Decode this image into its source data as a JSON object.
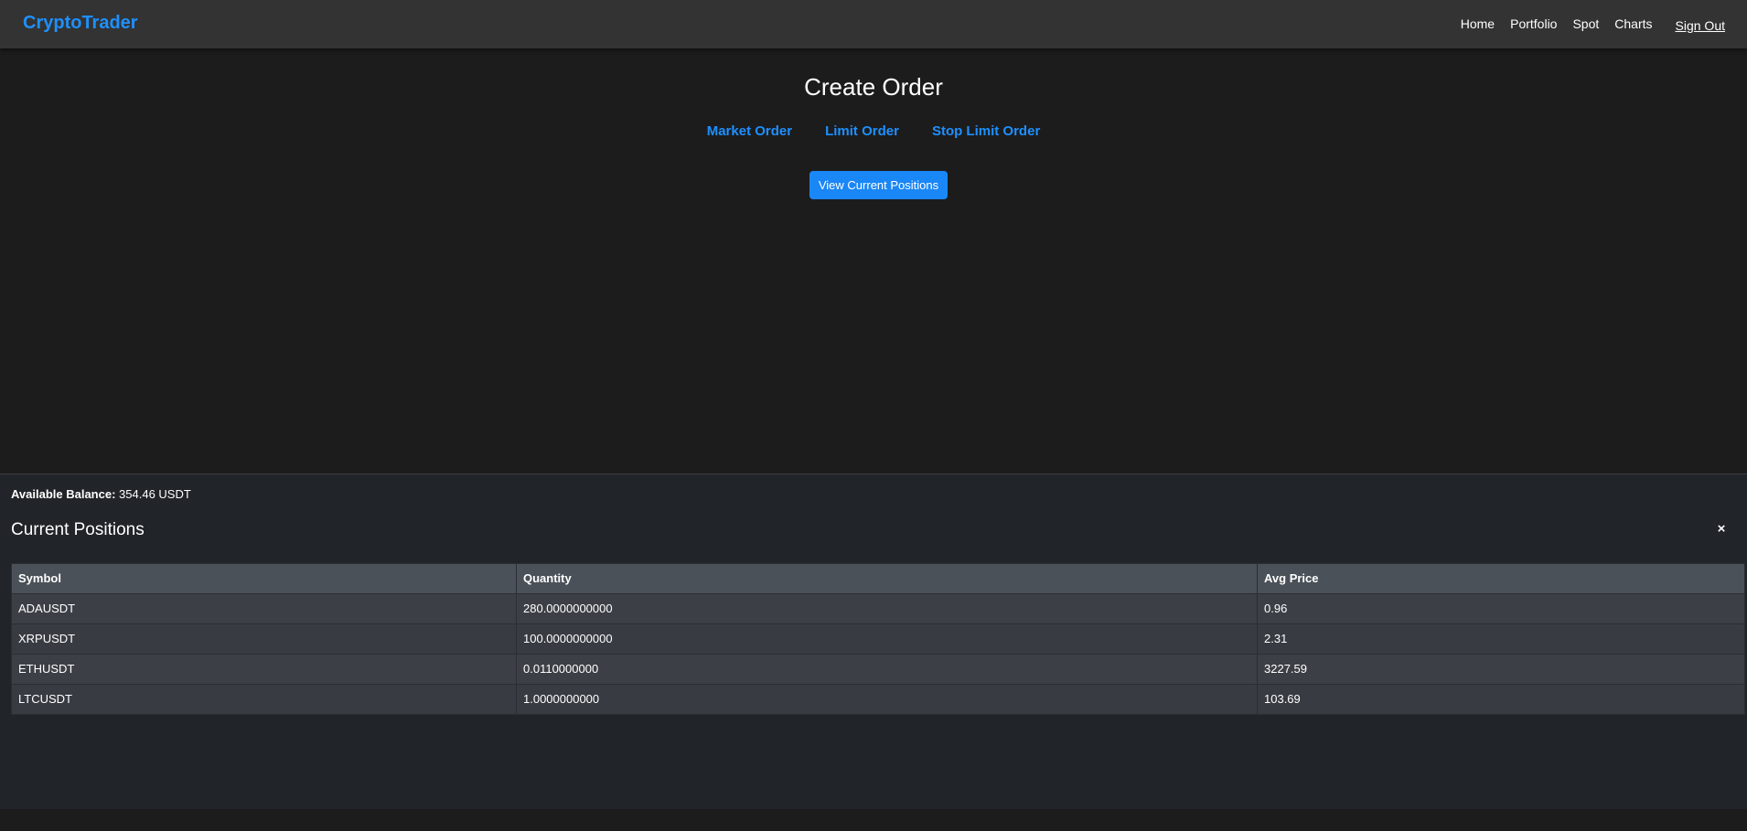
{
  "navbar": {
    "brand": "CryptoTrader",
    "links": [
      "Home",
      "Portfolio",
      "Spot",
      "Charts"
    ],
    "signout": "Sign Out"
  },
  "main": {
    "title": "Create Order",
    "order_types": [
      "Market Order",
      "Limit Order",
      "Stop Limit Order"
    ],
    "view_positions_button": "View Current Positions"
  },
  "positions_panel": {
    "balance_label": "Available Balance:",
    "balance_value": "354.46 USDT",
    "title": "Current Positions",
    "close_symbol": "×",
    "columns": [
      "Symbol",
      "Quantity",
      "Avg Price"
    ],
    "rows": [
      [
        "ADAUSDT",
        "280.0000000000",
        "0.96"
      ],
      [
        "XRPUSDT",
        "100.0000000000",
        "2.31"
      ],
      [
        "ETHUSDT",
        "0.0110000000",
        "3227.59"
      ],
      [
        "LTCUSDT",
        "1.0000000000",
        "103.69"
      ]
    ]
  },
  "colors": {
    "accent": "#1e90ff",
    "button": "#1a87f7",
    "background": "#1c1c1d",
    "navbar": "#333333",
    "panel": "#212428"
  }
}
